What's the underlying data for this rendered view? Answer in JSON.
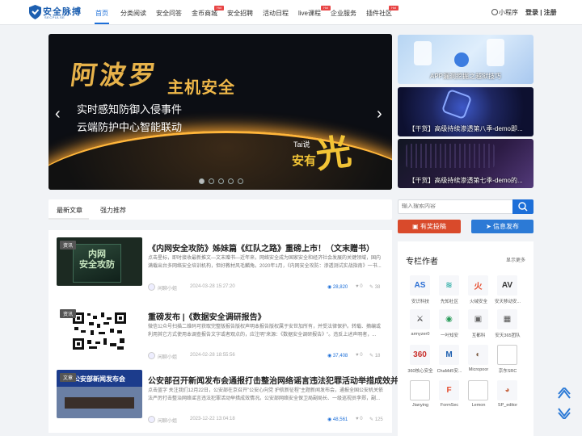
{
  "header": {
    "logo_text": "安全脉搏",
    "logo_sub": "SECPULSE",
    "nav": [
      {
        "label": "首页",
        "hot": false
      },
      {
        "label": "分类阅读",
        "hot": false
      },
      {
        "label": "安全问答",
        "hot": false
      },
      {
        "label": "金币商城",
        "hot": true
      },
      {
        "label": "安全招聘",
        "hot": false
      },
      {
        "label": "活动日程",
        "hot": false
      },
      {
        "label": "live课程",
        "hot": true
      },
      {
        "label": "企业服务",
        "hot": false
      },
      {
        "label": "插件社区",
        "hot": true
      }
    ],
    "hot_label": "Hot",
    "mini_program": "小程序",
    "login": "登录 | 注册"
  },
  "banner": {
    "title": "阿波罗",
    "title2": "主机安全",
    "line1": "实时感知防御入侵事件",
    "line2": "云端防护中心智能联动",
    "tai": "Tai说",
    "brand": "光",
    "brand2": "安有",
    "prev": "‹",
    "next": "›"
  },
  "thumbs": [
    {
      "caption": "APP漏洞挖掘之越狱技巧"
    },
    {
      "caption": "【干货】高级持续渗透第八季-demo即..."
    },
    {
      "caption": "【干货】高级持续渗透第七季-demo的..."
    }
  ],
  "tabs": [
    "最新文章",
    "强力推荐"
  ],
  "articles": [
    {
      "tag": "资讯",
      "title": "《内网安全攻防》姊妹篇《红队之路》重磅上市！（文末赠书）",
      "desc": "点击星标，即时接收最新推文—文末赠书—近年来，网络安全成为国家安全和经济社会发展的关键领域，国内满载出台多网络安全培训机构，但好教材风毛麟角。2020年1月，《内网安全攻防：渗透测试实战指南》一书...",
      "author": "闲聊小姐",
      "date": "2024-03-28 15:27:20",
      "views": "28,820",
      "likes": "0",
      "comments": "38",
      "img_text": "内网\n安全攻防"
    },
    {
      "tag": "资讯",
      "title": "重磅发布 |《数据安全调研报告》",
      "desc": "微信公众号扫描二维码可获取完整版报告版权声明本报告版权属于安世加所有，并受法律保护。转载、摘编或利用其它方式使用本调查报告文字或者观点的，应注明\"来源：《数据安全调研报告》\"。违反上述声明者，...",
      "author": "闲聊小姐",
      "date": "2024-02-28 18:55:56",
      "views": "37,408",
      "likes": "0",
      "comments": "18"
    },
    {
      "tag": "文章",
      "title": "公安部召开新闻发布会通报打击整治网络谣言违法犯罪活动举措成效并...",
      "desc": "点击蓝字 关注我们12月22日，公安部在京召开\"公安心向党 护航新征程\"主题新闻发布会，通报全国公安机关依法严厉打击整治网络谣言违法犯罪活动举措成效情况。公安部网络安全保卫局副局长、一级巡视员李郑，副...",
      "author": "闲聊小姐",
      "date": "2023-12-22 13:04:18",
      "views": "48,561",
      "likes": "0",
      "comments": "125",
      "img_text": "公安部新闻发布会"
    }
  ],
  "sidebar": {
    "search_placeholder": "输入搜索内容",
    "btn_post": "有奖投稿",
    "btn_publish": "信息发布",
    "authors_title": "专栏作者",
    "authors_more": "显示更多",
    "authors": [
      {
        "name": "安识科技",
        "color": "#2b6fd4",
        "glyph": "AS"
      },
      {
        "name": "先知社区",
        "color": "#1fa8a0",
        "glyph": "≋"
      },
      {
        "name": "火绒安全",
        "color": "#e64d2e",
        "glyph": "火"
      },
      {
        "name": "安天移动安...",
        "color": "#333",
        "glyph": "AV"
      },
      {
        "name": "armyzer0",
        "color": "#222",
        "glyph": "⚔"
      },
      {
        "name": "一叶知安",
        "color": "#2a9c5a",
        "glyph": "◉"
      },
      {
        "name": "互都科",
        "color": "#666",
        "glyph": "▣"
      },
      {
        "name": "安天365团队",
        "color": "#555",
        "glyph": "▦"
      },
      {
        "name": "360核心安全",
        "color": "#c9302c",
        "glyph": "360"
      },
      {
        "name": "ChaMd5安...",
        "color": "#1d5fb0",
        "glyph": "M"
      },
      {
        "name": "Micropoor",
        "color": "#7a5a40",
        "glyph": "◐"
      },
      {
        "name": "京东SRC",
        "color": "#ccc",
        "glyph": ""
      },
      {
        "name": "Jianying",
        "color": "#ccc",
        "glyph": ""
      },
      {
        "name": "FormSec",
        "color": "#e64d2e",
        "glyph": "F"
      },
      {
        "name": "Lemon",
        "color": "#ccc",
        "glyph": ""
      },
      {
        "name": "SP_editor",
        "color": "#c86b4a",
        "glyph": "◕"
      }
    ]
  }
}
